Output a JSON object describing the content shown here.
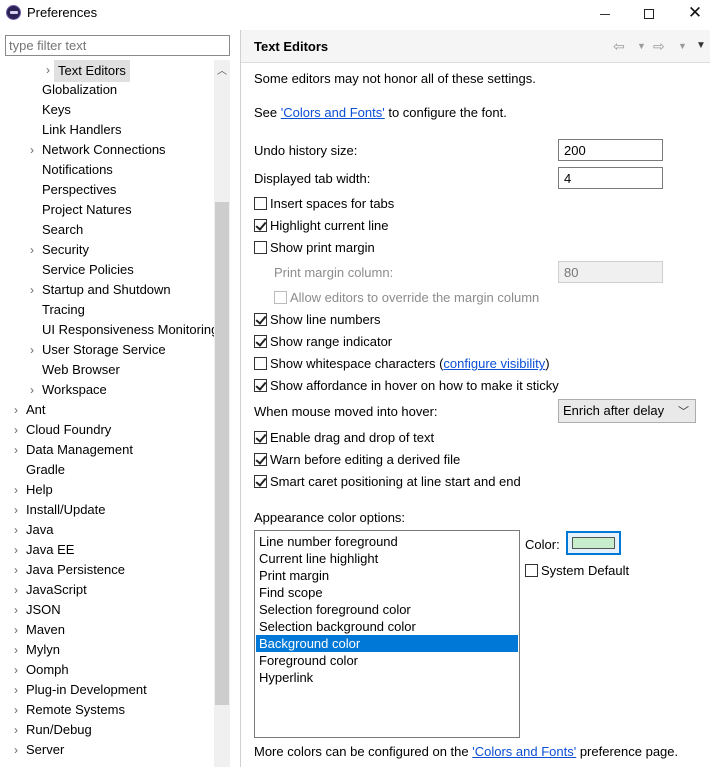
{
  "window": {
    "title": "Preferences"
  },
  "filter": {
    "placeholder": "type filter text"
  },
  "tree": {
    "items": [
      {
        "label": "Text Editors",
        "expandable": true,
        "selected": true
      },
      {
        "label": "Globalization",
        "expandable": false
      },
      {
        "label": "Keys",
        "expandable": false
      },
      {
        "label": "Link Handlers",
        "expandable": false
      },
      {
        "label": "Network Connections",
        "expandable": true
      },
      {
        "label": "Notifications",
        "expandable": false
      },
      {
        "label": "Perspectives",
        "expandable": false
      },
      {
        "label": "Project Natures",
        "expandable": false
      },
      {
        "label": "Search",
        "expandable": false
      },
      {
        "label": "Security",
        "expandable": true
      },
      {
        "label": "Service Policies",
        "expandable": false
      },
      {
        "label": "Startup and Shutdown",
        "expandable": true
      },
      {
        "label": "Tracing",
        "expandable": false
      },
      {
        "label": "UI Responsiveness Monitoring",
        "expandable": false
      },
      {
        "label": "User Storage Service",
        "expandable": true
      },
      {
        "label": "Web Browser",
        "expandable": false
      },
      {
        "label": "Workspace",
        "expandable": true
      },
      {
        "label": "Ant",
        "expandable": true
      },
      {
        "label": "Cloud Foundry",
        "expandable": true
      },
      {
        "label": "Data Management",
        "expandable": true
      },
      {
        "label": "Gradle",
        "expandable": false
      },
      {
        "label": "Help",
        "expandable": true
      },
      {
        "label": "Install/Update",
        "expandable": true
      },
      {
        "label": "Java",
        "expandable": true
      },
      {
        "label": "Java EE",
        "expandable": true
      },
      {
        "label": "Java Persistence",
        "expandable": true
      },
      {
        "label": "JavaScript",
        "expandable": true
      },
      {
        "label": "JSON",
        "expandable": true
      },
      {
        "label": "Maven",
        "expandable": true
      },
      {
        "label": "Mylyn",
        "expandable": true
      },
      {
        "label": "Oomph",
        "expandable": true
      },
      {
        "label": "Plug-in Development",
        "expandable": true
      },
      {
        "label": "Remote Systems",
        "expandable": true
      },
      {
        "label": "Run/Debug",
        "expandable": true
      },
      {
        "label": "Server",
        "expandable": true
      }
    ]
  },
  "page": {
    "title": "Text Editors",
    "note": "Some editors may not honor all of these settings.",
    "see_prefix": "See ",
    "colors_fonts_link": "'Colors and Fonts'",
    "see_suffix": " to configure the font.",
    "undo_label": "Undo history size:",
    "undo_value": "200",
    "tab_width_label": "Displayed tab width:",
    "tab_width_value": "4",
    "insert_spaces": {
      "label": "Insert spaces for tabs",
      "checked": false
    },
    "highlight_line": {
      "label": "Highlight current line",
      "checked": true
    },
    "show_print_margin": {
      "label": "Show print margin",
      "checked": false
    },
    "print_margin_label": "Print margin column:",
    "print_margin_value": "80",
    "allow_override": {
      "label": "Allow editors to override the margin column",
      "checked": false
    },
    "show_line_numbers": {
      "label": "Show line numbers",
      "checked": true
    },
    "show_range": {
      "label": "Show range indicator",
      "checked": true
    },
    "show_whitespace": {
      "label": "Show whitespace characters (",
      "link": "configure visibility",
      "suffix": ")",
      "checked": false
    },
    "show_affordance": {
      "label": "Show affordance in hover on how to make it sticky",
      "checked": true
    },
    "hover_label": "When mouse moved into hover:",
    "hover_value": "Enrich after delay",
    "enable_dnd": {
      "label": "Enable drag and drop of text",
      "checked": true
    },
    "warn_derived": {
      "label": "Warn before editing a derived file",
      "checked": true
    },
    "smart_caret": {
      "label": "Smart caret positioning at line start and end",
      "checked": true
    },
    "appearance_label": "Appearance color options:",
    "color_options": [
      "Line number foreground",
      "Current line highlight",
      "Print margin",
      "Find scope",
      "Selection foreground color",
      "Selection background color",
      "Background color",
      "Foreground color",
      "Hyperlink"
    ],
    "selected_color_option": 6,
    "color_label": "Color:",
    "color_value": "#c7edcc",
    "system_default": {
      "label": "System Default",
      "checked": false
    },
    "more_colors_prefix": "More colors can be configured on the ",
    "more_colors_link": "'Colors and Fonts'",
    "more_colors_suffix": " preference page."
  }
}
